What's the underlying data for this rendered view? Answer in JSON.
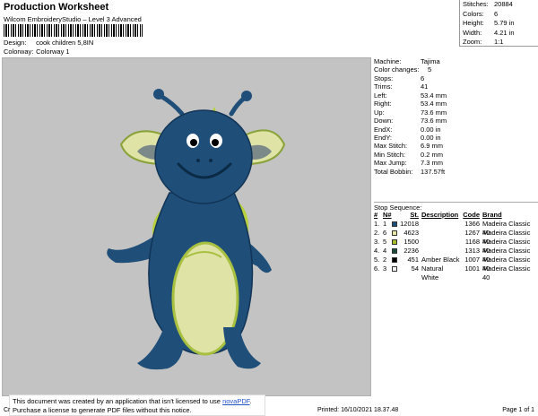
{
  "header": {
    "title": "Production Worksheet",
    "subtitle": "Wilcom EmbroideryStudio – Level 3 Advanced",
    "design_label": "Design:",
    "design_value": "cook children 5,8IN",
    "colorway_label": "Colorway:",
    "colorway_value": "Colorway 1"
  },
  "summary": [
    {
      "label": "Stitches:",
      "value": "20884"
    },
    {
      "label": "Colors:",
      "value": "6"
    },
    {
      "label": "Height:",
      "value": "5.79 in"
    },
    {
      "label": "Width:",
      "value": "4.21 in"
    },
    {
      "label": "Zoom:",
      "value": "1:1"
    }
  ],
  "info": [
    {
      "label": "Machine:",
      "value": "Tajima"
    },
    {
      "label": "Color changes:",
      "value": "5"
    },
    {
      "label": "Stops:",
      "value": "6"
    },
    {
      "label": "Trims:",
      "value": "41"
    },
    {
      "label": "Left:",
      "value": "53.4 mm"
    },
    {
      "label": "Right:",
      "value": "53.4 mm"
    },
    {
      "label": "Up:",
      "value": "73.6 mm"
    },
    {
      "label": "Down:",
      "value": "73.6 mm"
    },
    {
      "label": "EndX:",
      "value": "0.00 in"
    },
    {
      "label": "EndY:",
      "value": "0.00 in"
    },
    {
      "label": "Max Stitch:",
      "value": "6.9 mm"
    },
    {
      "label": "Min Stitch:",
      "value": "0.2 mm"
    },
    {
      "label": "Max Jump:",
      "value": "7.3 mm"
    },
    {
      "label": "Total Bobbin:",
      "value": "137.57ft"
    }
  ],
  "stop_sequence": {
    "label": "Stop Sequence:",
    "headers": [
      "#",
      "N#",
      "St.",
      "Description",
      "Code",
      "Brand"
    ],
    "rows": [
      {
        "num": "1.",
        "n": "1",
        "color": "#1f4e79",
        "st": "12018",
        "desc": "",
        "code": "1366",
        "brand": "Madeira Classic 40"
      },
      {
        "num": "2.",
        "n": "6",
        "color": "#e6e6a8",
        "st": "4623",
        "desc": "",
        "code": "1267",
        "brand": "Madeira Classic 40"
      },
      {
        "num": "3.",
        "n": "5",
        "color": "#a3c02a",
        "st": "1500",
        "desc": "",
        "code": "1168",
        "brand": "Madeira Classic 40"
      },
      {
        "num": "4.",
        "n": "4",
        "color": "#1b4d3e",
        "st": "2236",
        "desc": "",
        "code": "1313",
        "brand": "Madeira Classic 40"
      },
      {
        "num": "5.",
        "n": "2",
        "color": "#000000",
        "st": "451",
        "desc": "Amber Black",
        "code": "1007",
        "brand": "Madeira Classic 40"
      },
      {
        "num": "6.",
        "n": "3",
        "color": "#f4f4f4",
        "st": "54",
        "desc": "Natural White",
        "code": "1001",
        "brand": "Madeira Classic 40"
      }
    ]
  },
  "notice": {
    "line1_pre": "This document was created by an application that isn't licensed to use ",
    "link": "novaPDF",
    "line1_post": ".",
    "line2": "Purchase a license to generate PDF files without this notice."
  },
  "footer": {
    "left": "Cr",
    "printed": "Printed: 16/10/2021 18.37.48",
    "page": "Page 1 of 1"
  }
}
